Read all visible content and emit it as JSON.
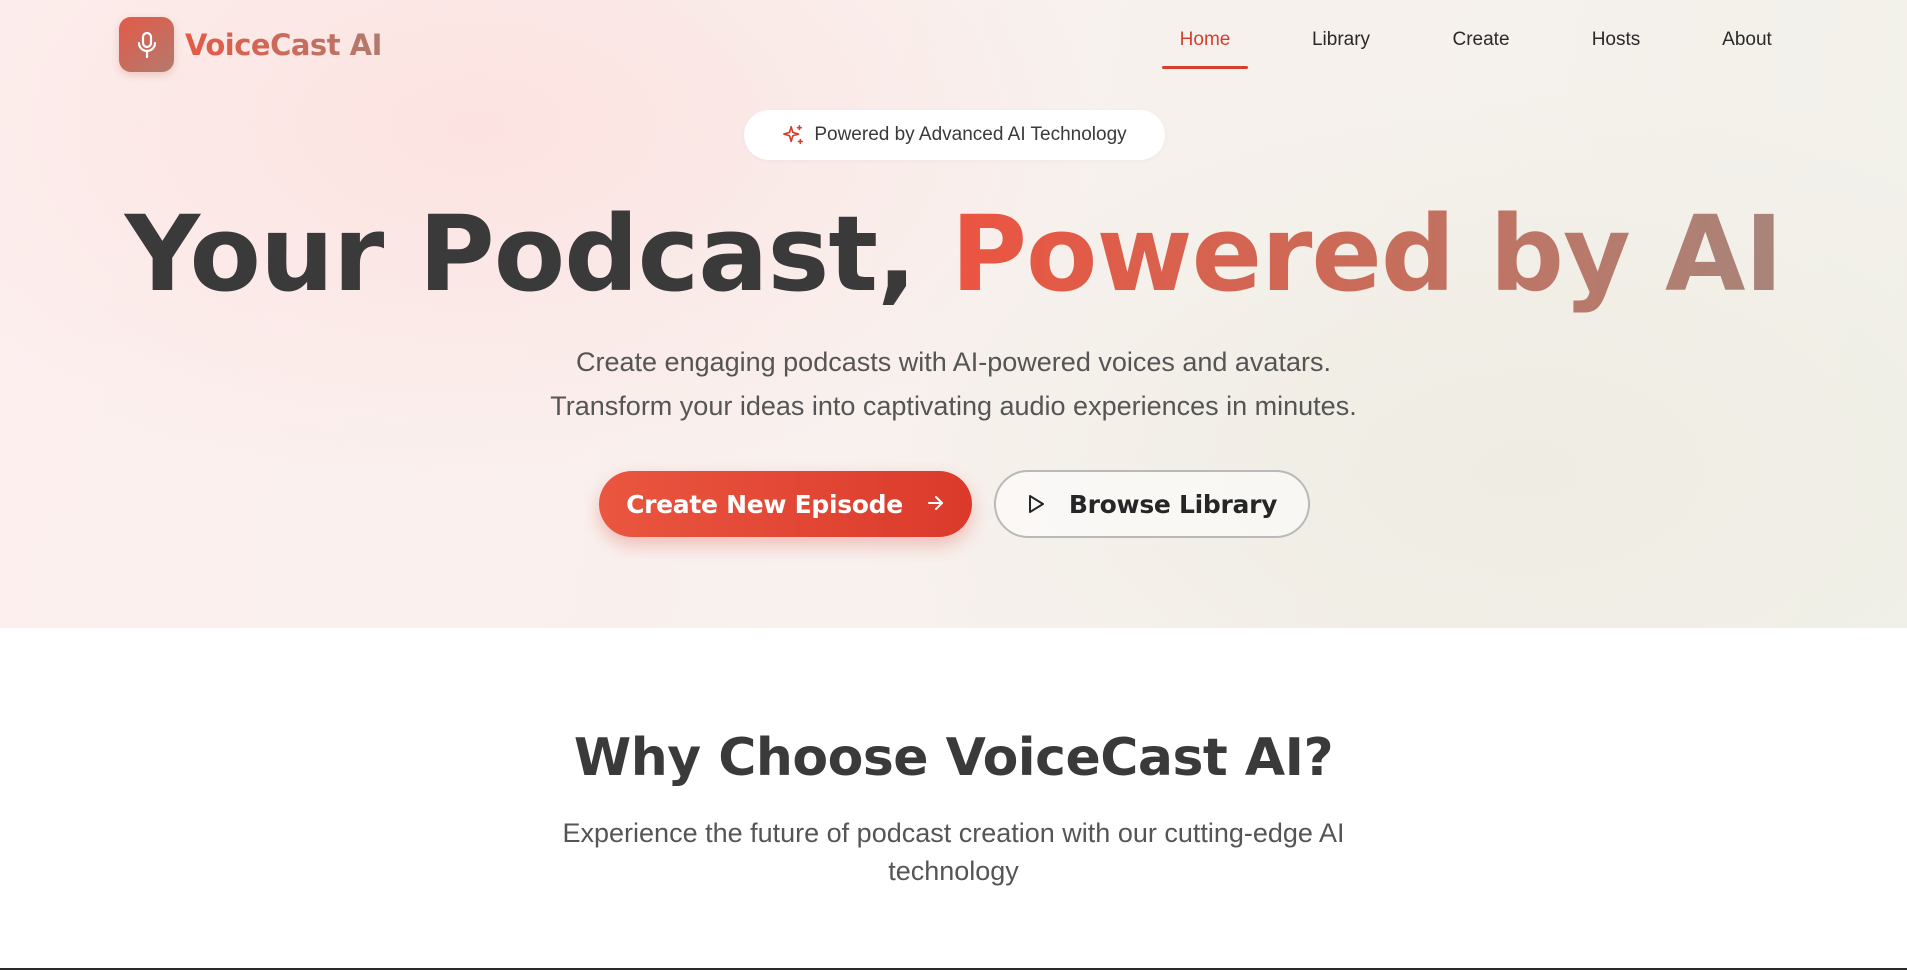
{
  "header": {
    "logo_text": "VoiceCast AI",
    "logo_icon": "microphone-icon",
    "nav": [
      {
        "label": "Home",
        "active": true
      },
      {
        "label": "Library",
        "active": false
      },
      {
        "label": "Create",
        "active": false
      },
      {
        "label": "Hosts",
        "active": false
      },
      {
        "label": "About",
        "active": false
      }
    ]
  },
  "hero": {
    "badge": {
      "icon": "sparkles-icon",
      "text": "Powered by Advanced AI Technology"
    },
    "headline_part1": "Your Podcast, ",
    "headline_part2": "Powered by AI",
    "subtitle_line1": "Create engaging podcasts with AI-powered voices and avatars.",
    "subtitle_line2": "Transform your ideas into captivating audio experiences in minutes.",
    "primary_button": {
      "label": "Create New Episode",
      "icon": "arrow-right-icon"
    },
    "secondary_button": {
      "label": "Browse Library",
      "icon": "play-icon"
    }
  },
  "features": {
    "title": "Why Choose VoiceCast AI?",
    "subtitle_line1": "Experience the future of podcast creation with our cutting-edge AI",
    "subtitle_line2": "technology"
  },
  "colors": {
    "accent": "#d63f2e",
    "primary_gradient_start": "#ea5640",
    "primary_gradient_end": "#db3a2b",
    "text_dark": "#3a3a3a"
  }
}
